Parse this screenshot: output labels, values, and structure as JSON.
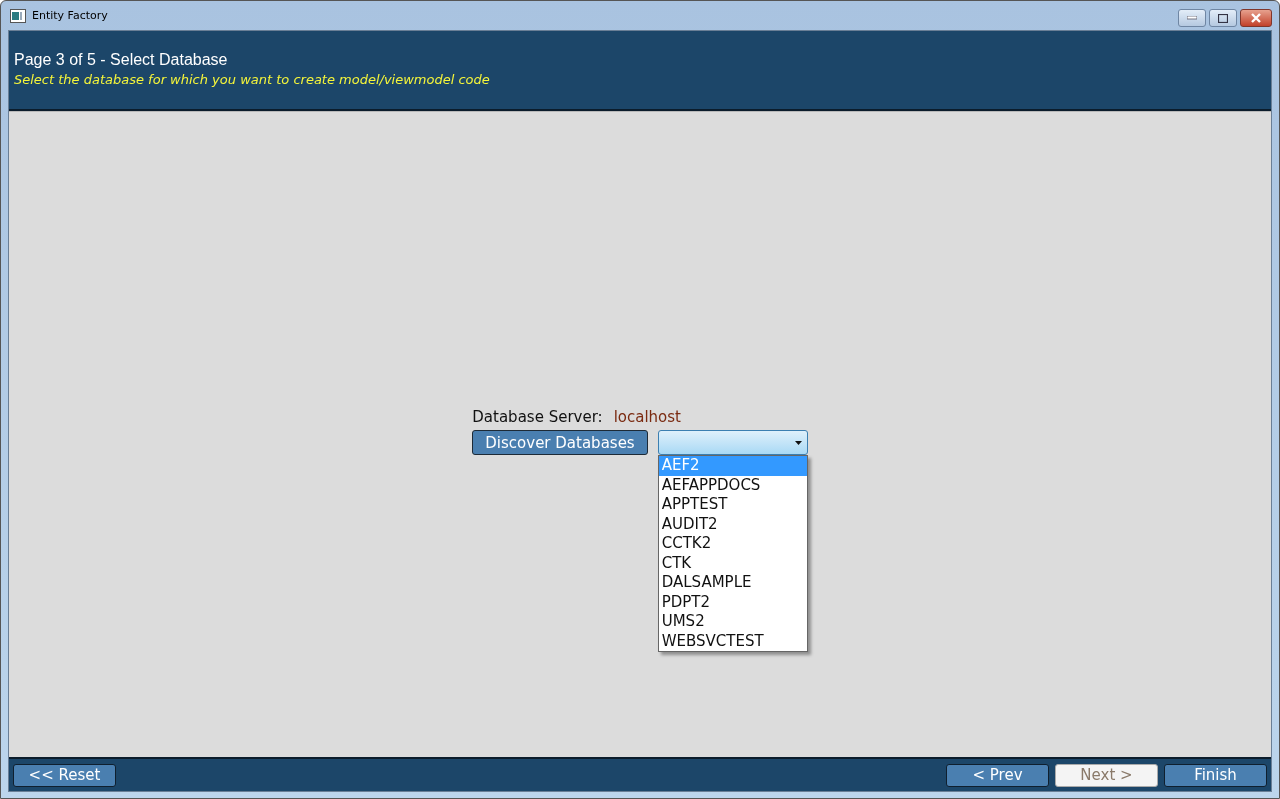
{
  "window": {
    "title": "Entity Factory"
  },
  "header": {
    "title": "Page 3 of 5 - Select Database",
    "subtitle": "Select the database for which you want to create model/viewmodel code"
  },
  "server": {
    "label": "Database Server:",
    "value": "localhost"
  },
  "discover_button": "Discover Databases",
  "database_dropdown": {
    "expanded": true,
    "options": [
      {
        "label": "AEF2",
        "selected": true
      },
      {
        "label": "AEFAPPDOCS",
        "selected": false
      },
      {
        "label": "APPTEST",
        "selected": false
      },
      {
        "label": "AUDIT2",
        "selected": false
      },
      {
        "label": "CCTK2",
        "selected": false
      },
      {
        "label": "CTK",
        "selected": false
      },
      {
        "label": "DALSAMPLE",
        "selected": false
      },
      {
        "label": "PDPT2",
        "selected": false
      },
      {
        "label": "UMS2",
        "selected": false
      },
      {
        "label": "WEBSVCTEST",
        "selected": false
      }
    ]
  },
  "footer": {
    "left_buttons": [
      {
        "label": "<< Reset",
        "disabled": false
      }
    ],
    "right_buttons": [
      {
        "label": "< Prev",
        "disabled": false
      },
      {
        "label": "Next >",
        "disabled": true
      },
      {
        "label": "Finish",
        "disabled": false
      }
    ]
  }
}
